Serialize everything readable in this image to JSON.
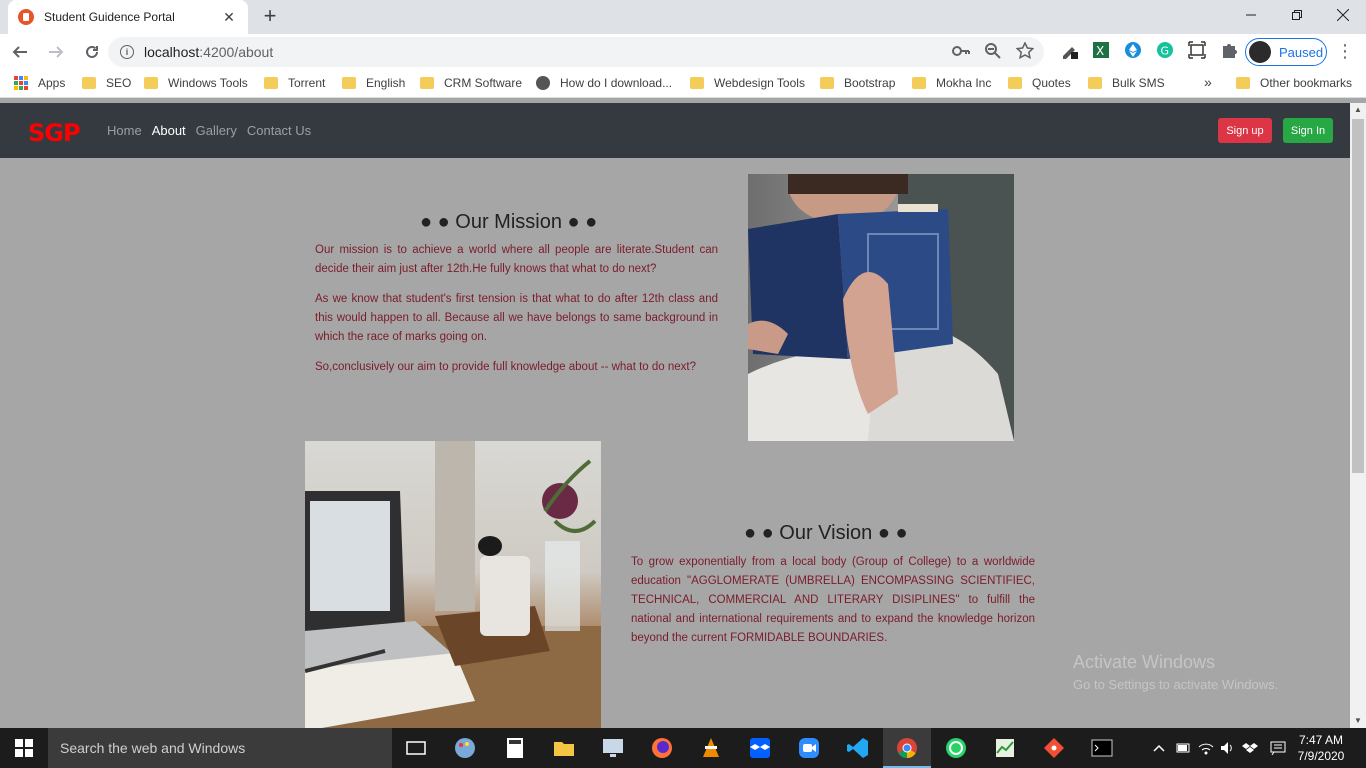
{
  "browser": {
    "tab_title": "Student Guidence Portal",
    "tab_close": "✕",
    "new_tab": "+",
    "url_host": "localhost",
    "url_rest": ":4200/about",
    "profile_status": "Paused",
    "bookmarks": [
      "Apps",
      "SEO",
      "Windows Tools",
      "Torrent",
      "English",
      "CRM Software",
      "How do I download...",
      "Webdesign Tools",
      "Bootstrap",
      "Mokha Inc",
      "Quotes",
      "Bulk SMS"
    ],
    "bookmarks_more": "»",
    "other_bookmarks": "Other bookmarks"
  },
  "site": {
    "brand": "SGP",
    "nav": [
      "Home",
      "About",
      "Gallery",
      "Contact Us"
    ],
    "active_nav": "About",
    "signup_label": "Sign up",
    "signin_label": "Sign In"
  },
  "mission": {
    "title": "● ● Our Mission ● ●",
    "paragraphs": [
      "Our mission is to achieve a world where all people are literate.Student can decide their aim just after 12th.He fully knows that what to do next?",
      "As we know that student's first tension is that what to do after 12th class and this would happen to all. Because all we have belongs to same background in which the race of marks going on.",
      "So,conclusively our aim to provide full knowledge about -- what to do next?"
    ]
  },
  "vision": {
    "title": "● ● Our Vision ● ●",
    "text": "To grow exponentially from a local body (Group of College) to a worldwide education \"AGGLOMERATE (UMBRELLA) ENCOMPASSING SCIENTIFIEC, TECHNICAL, COMMERCIAL AND LITERARY DISIPLINES\" to fulfill the national and international requirements and to expand the knowledge horizon beyond the current FORMIDABLE BOUNDARIES."
  },
  "watermark": {
    "title": "Activate Windows",
    "subtitle": "Go to Settings to activate Windows."
  },
  "taskbar": {
    "search_placeholder": "Search the web and Windows",
    "time": "7:47 AM",
    "date": "7/9/2020"
  }
}
